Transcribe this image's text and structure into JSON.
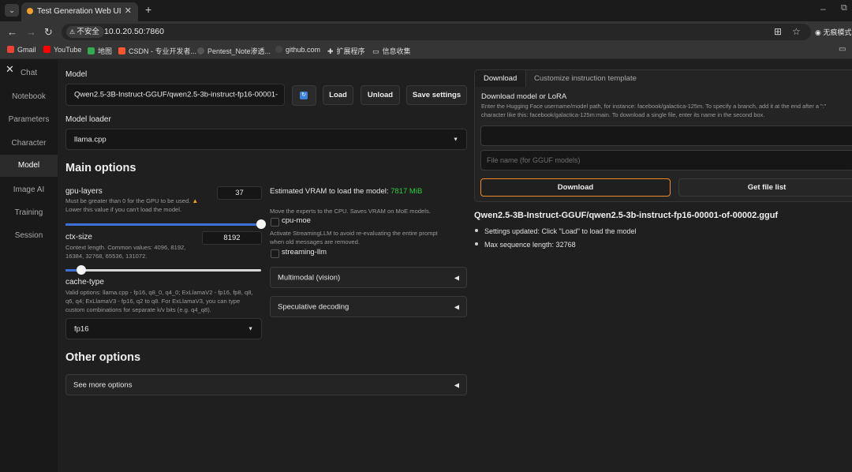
{
  "browser": {
    "tab_title": "Test Generation Web UI",
    "tab_close": "✕",
    "new_tab": "+",
    "tab_menu": "⌄",
    "insecure_label": "不安全",
    "url": "10.0.20.50:7860",
    "profile_label": "无痕模式",
    "window_min": "–",
    "window_other": "⧉",
    "bookmarks": [
      "Gmail",
      "YouTube",
      "地图",
      "CSDN - 专业开发者...",
      "Pentest_Note渗透...",
      "github.com",
      "扩展程序",
      "信息收集"
    ],
    "bookmark_colors": [
      "#ea4335",
      "#ff0000",
      "#34a853",
      "#fc5531",
      "#555555",
      "#444444",
      "#bbbbbb",
      "#bbbbbb"
    ]
  },
  "sidebar": {
    "close_icon": "✕",
    "items": [
      "Chat",
      "Notebook",
      "Parameters",
      "Character",
      "Model",
      "Image AI",
      "Training",
      "Session"
    ],
    "active": "Model"
  },
  "model": {
    "label": "Model",
    "value": "Qwen2.5-3B-Instruct-GGUF/qwen2.5-3b-instruct-fp16-00001-",
    "refresh_icon": "↻",
    "load_label": "Load",
    "unload_label": "Unload",
    "save_label": "Save settings",
    "loader_label": "Model loader",
    "loader_value": "llama.cpp",
    "caret": "▼"
  },
  "main_options": {
    "title": "Main options",
    "gpu_layers_label": "gpu-layers",
    "gpu_layers_value": "37",
    "gpu_layers_info_1": "Must be greater than 0 for the GPU to be used.",
    "gpu_layers_info_2": "Lower this value if you can't load the model.",
    "gpu_layers_fill": 1.0,
    "ctx_size_label": "ctx-size",
    "ctx_size_value": "8192",
    "ctx_size_info_1": "Context length. Common values: 4096, 8192,",
    "ctx_size_info_2": "16384, 32768, 65536, 131072.",
    "ctx_size_fill": 0.08,
    "cache_type_label": "cache-type",
    "cache_type_info_1": "Valid options: llama.cpp - fp16, q8_0, q4_0; ExLlamaV2 - fp16, fp8, q8,",
    "cache_type_info_2": "q6, q4; ExLlamaV3 - fp16, q2 to q8. For ExLlamaV3, you can type",
    "cache_type_info_3": "custom combinations for separate k/v bits (e.g. q4_q8).",
    "cache_type_value": "fp16",
    "vram_label": "Estimated VRAM to load the model:",
    "vram_value": "7817 MiB",
    "vram_color": "#2ecc40",
    "cpu_moe_info": "Move the experts to the CPU. Saves VRAM on MoE models.",
    "cpu_moe_label": "cpu-moe",
    "streaming_info_1": "Activate StreamingLLM to avoid re-evaluating the entire prompt",
    "streaming_info_2": "when old messages are removed.",
    "streaming_label": "streaming-llm",
    "multimodal_label": "Multimodal (vision)",
    "speculative_label": "Speculative decoding",
    "acc_caret": "◀"
  },
  "other_options": {
    "title": "Other options",
    "see_more_label": "See more options"
  },
  "download": {
    "tab_download": "Download",
    "tab_customize": "Customize instruction template",
    "title": "Download model or LoRA",
    "info_1": "Enter the Hugging Face username/model path, for instance: facebook/galactica-125m. To specify a branch, add it at the end after a \":\"",
    "info_2": "character like this: facebook/galactica-125m:main. To download a single file, enter its name in the second box.",
    "file_placeholder": "File name (for GGUF models)",
    "download_btn": "Download",
    "file_list_btn": "Get file list",
    "accent": "#f08a24"
  },
  "status": {
    "title": "Qwen2.5-3B-Instruct-GGUF/qwen2.5-3b-instruct-fp16-00001-of-00002.gguf",
    "items": [
      "Settings updated: Click \"Load\" to load the model",
      "Max sequence length: 32768"
    ]
  }
}
